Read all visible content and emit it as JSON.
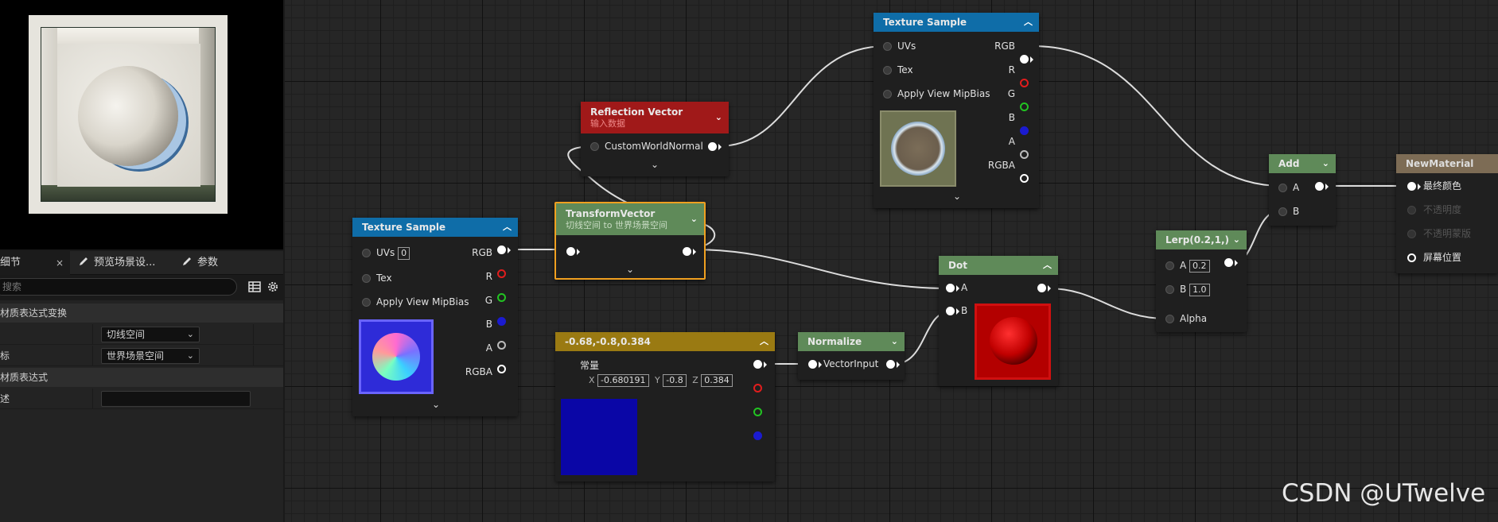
{
  "details_panel": {
    "tabs": [
      {
        "label": "细节",
        "close": "×"
      },
      {
        "label": "预览场景设..."
      },
      {
        "label": "参数"
      }
    ],
    "search_placeholder": "搜索",
    "categories": [
      "材质表达式变换",
      "材质表达式"
    ],
    "rows": [
      {
        "label": "",
        "value": "切线空间"
      },
      {
        "label": "标",
        "value": "世界场景空间"
      },
      {
        "label": "述",
        "value": ""
      }
    ]
  },
  "graph": {
    "nodes": {
      "texture_sample_top": {
        "title": "Texture Sample",
        "title_color": "#0f6da8",
        "inputs": [
          "UVs",
          "Tex",
          "Apply View MipBias"
        ],
        "outputs": [
          "RGB",
          "R",
          "G",
          "B",
          "A",
          "RGBA"
        ]
      },
      "reflection_vector": {
        "title": "Reflection Vector",
        "subtitle": "输入数据",
        "title_color": "#a01919",
        "inputs": [
          "CustomWorldNormal"
        ]
      },
      "transform_vector": {
        "title": "TransformVector",
        "subtitle": "切线空间 to 世界场景空间",
        "title_color": "#5f8a59",
        "border_color": "#f0a020"
      },
      "texture_sample_left": {
        "title": "Texture Sample",
        "title_color": "#0f6da8",
        "inputs": [
          "UVs",
          "Tex",
          "Apply View MipBias"
        ],
        "uv_value": "0",
        "outputs": [
          "RGB",
          "R",
          "G",
          "B",
          "A",
          "RGBA"
        ]
      },
      "constant_vector": {
        "title": "-0.68,-0.8,0.384",
        "title_color": "#9a7a12",
        "label": "常量",
        "x_label": "X",
        "x_value": "-0.680191",
        "y_label": "Y",
        "y_value": "-0.8",
        "z_label": "Z",
        "z_value": "0.384",
        "swatch_color": "#0a06a6"
      },
      "normalize": {
        "title": "Normalize",
        "title_color": "#5f8a59",
        "inputs": [
          "VectorInput"
        ]
      },
      "dot": {
        "title": "Dot",
        "title_color": "#5f8a59",
        "inputs": [
          "A",
          "B"
        ]
      },
      "lerp": {
        "title": "Lerp(0.2,1,)",
        "title_color": "#5f8a59",
        "inputs": [
          "A",
          "B",
          "Alpha"
        ],
        "a_value": "0.2",
        "b_value": "1.0"
      },
      "add": {
        "title": "Add",
        "title_color": "#5f8a59",
        "inputs": [
          "A",
          "B"
        ]
      },
      "new_material": {
        "title": "NewMaterial",
        "title_color": "#7d6c55",
        "inputs": [
          "最终颜色",
          "不透明度",
          "不透明蒙版",
          "屏幕位置"
        ]
      }
    }
  },
  "watermark": "CSDN @UTwelve",
  "colors": {
    "pin_red": "#e11d1d",
    "pin_green": "#22c322",
    "pin_blue": "#1b1bd0",
    "pin_white": "#ffffff"
  }
}
